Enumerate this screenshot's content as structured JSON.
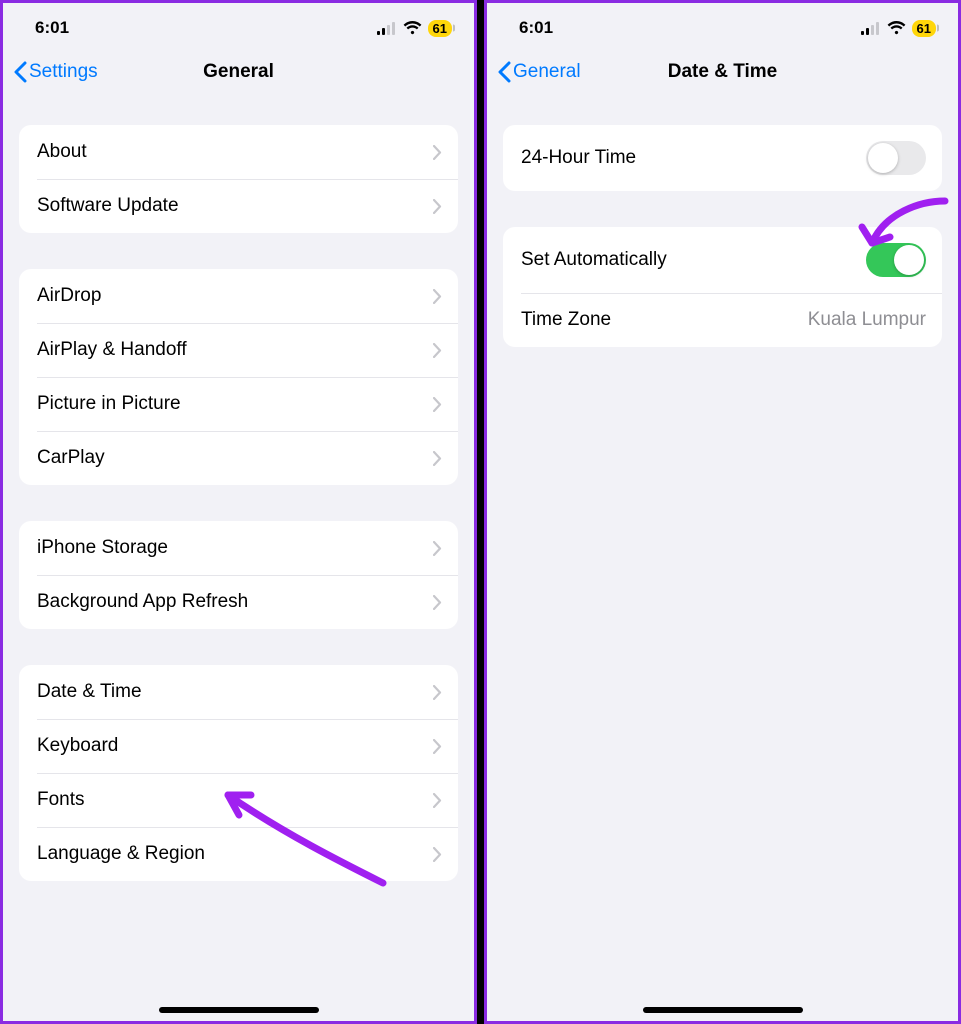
{
  "status": {
    "time": "6:01",
    "battery": "61"
  },
  "left": {
    "back_label": "Settings",
    "title": "General",
    "groups": [
      {
        "rows": [
          {
            "label": "About"
          },
          {
            "label": "Software Update"
          }
        ]
      },
      {
        "rows": [
          {
            "label": "AirDrop"
          },
          {
            "label": "AirPlay & Handoff"
          },
          {
            "label": "Picture in Picture"
          },
          {
            "label": "CarPlay"
          }
        ]
      },
      {
        "rows": [
          {
            "label": "iPhone Storage"
          },
          {
            "label": "Background App Refresh"
          }
        ]
      },
      {
        "rows": [
          {
            "label": "Date & Time"
          },
          {
            "label": "Keyboard"
          },
          {
            "label": "Fonts"
          },
          {
            "label": "Language & Region"
          }
        ]
      }
    ]
  },
  "right": {
    "back_label": "General",
    "title": "Date & Time",
    "row_24h": "24-Hour Time",
    "row_auto": "Set Automatically",
    "row_tz": "Time Zone",
    "tz_value": "Kuala Lumpur"
  }
}
